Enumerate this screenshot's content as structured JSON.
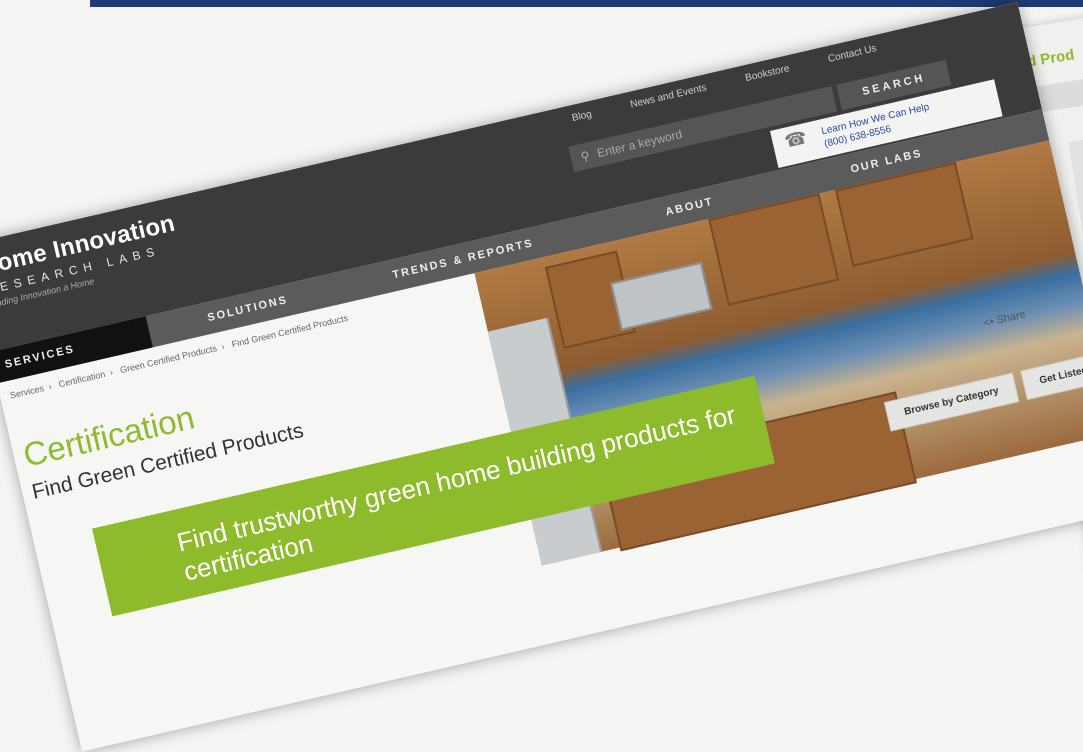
{
  "header": {
    "logo_title": "Home Innovation",
    "logo_subtitle": "RESEARCH LABS",
    "logo_tagline": "Finding Innovation a Home"
  },
  "utility": {
    "links": [
      "Blog",
      "News and Events",
      "Bookstore",
      "Contact Us"
    ]
  },
  "search": {
    "placeholder": "Enter a keyword",
    "button": "SEARCH"
  },
  "nav": {
    "services": "SERVICES",
    "solutions": "SOLUTIONS",
    "trends": "TRENDS & REPORTS",
    "about": "ABOUT",
    "labs": "OUR LABS"
  },
  "help": {
    "line1": "Learn How We Can Help",
    "line2": "(800) 638-8556"
  },
  "breadcrumb": [
    "Services",
    "Certification",
    "Green Certified Products",
    "Find Green Certified Products"
  ],
  "main": {
    "title": "Certification",
    "subtitle": "Find Green Certified Products",
    "banner": "Find trustworthy green home building products for certification"
  },
  "actions": {
    "share": "Share",
    "browse": "Browse by Category",
    "listed": "Get Listed"
  },
  "behind": {
    "title": "d Prod"
  },
  "colors": {
    "accent_green": "#8dbb2c",
    "header_dark": "#3b3b3b",
    "top_bar": "#1d3b76"
  }
}
